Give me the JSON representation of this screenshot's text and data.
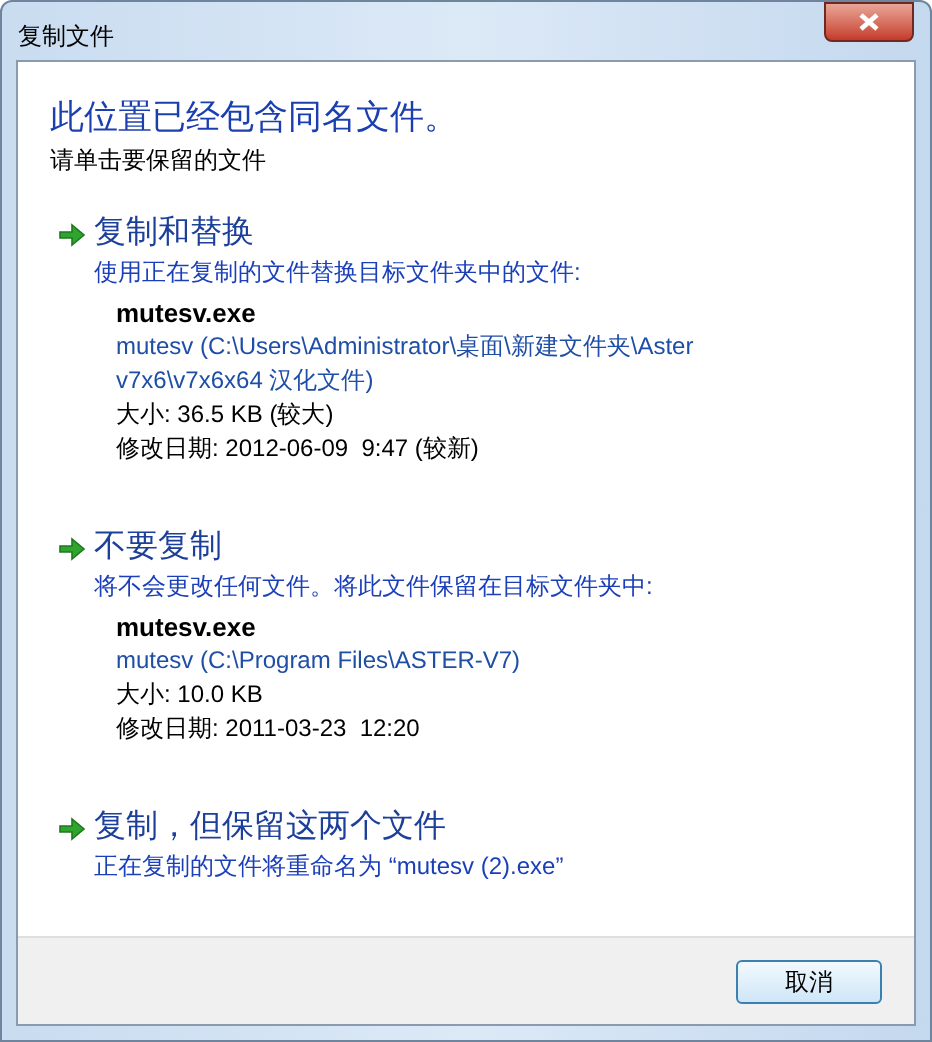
{
  "window": {
    "title": "复制文件"
  },
  "heading": "此位置已经包含同名文件。",
  "subheading": "请单击要保留的文件",
  "options": [
    {
      "title": "复制和替换",
      "description": "使用正在复制的文件替换目标文件夹中的文件:",
      "file": {
        "name": "mutesv.exe",
        "location": "mutesv (C:\\Users\\Administrator\\桌面\\新建文件夹\\Aster v7x6\\v7x6x64 汉化文件)",
        "size": "大小: 36.5 KB (较大)",
        "modified": "修改日期: 2012-06-09  9:47 (较新)"
      }
    },
    {
      "title": "不要复制",
      "description": "将不会更改任何文件。将此文件保留在目标文件夹中:",
      "file": {
        "name": "mutesv.exe",
        "location": "mutesv (C:\\Program Files\\ASTER-V7)",
        "size": "大小: 10.0 KB",
        "modified": "修改日期: 2011-03-23  12:20"
      }
    },
    {
      "title": "复制，但保留这两个文件",
      "description": "正在复制的文件将重命名为 “mutesv (2).exe”"
    }
  ],
  "buttons": [
    {
      "label": "取消"
    }
  ]
}
